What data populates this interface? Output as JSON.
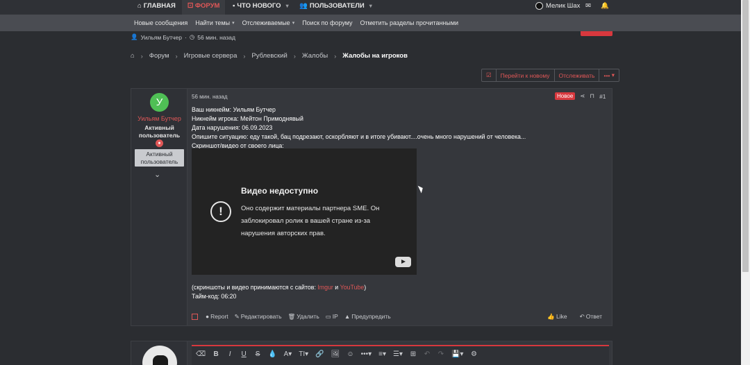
{
  "topnav": {
    "items": [
      {
        "label": "ГЛАВНАЯ",
        "icon": "home-icon"
      },
      {
        "label": "⚀ ФОРУМ",
        "active": true
      },
      {
        "label": "ЧТО НОВОГО",
        "icon": "comment-icon"
      },
      {
        "label": "ПОЛЬЗОВАТЕЛИ",
        "icon": "users-icon"
      }
    ],
    "user_name": "Мелик Шах"
  },
  "subnav": {
    "items": [
      "Новые сообщения",
      "Найти темы",
      "Отслеживаемые",
      "Поиск по форуму",
      "Отметить разделы прочитанными"
    ]
  },
  "thread_meta": {
    "author": "Уильям Бутчер",
    "time": "56 мин. назад"
  },
  "breadcrumb": [
    "Форум",
    "Игровые сервера",
    "Рублевский",
    "Жалобы",
    "Жалобы на игроков"
  ],
  "actions": {
    "goto_new": "Перейти к новому",
    "watch": "Отслеживать",
    "more": "•••"
  },
  "post": {
    "avatar_letter": "У",
    "username": "Уильям Бутчер",
    "user_title": "Активный пользователь",
    "user_banner": "Активный пользователь",
    "time": "56 мин. назад",
    "new_badge": "Новое",
    "number": "#1",
    "lines": [
      "Ваш никнейм: Уильям Бутчер",
      "Никнейм игрока: Мейтон Примоднявый",
      "Дата нарушения: 06.09.2023",
      "Опишите ситуацию: еду такой, бац подрезают, оскорбляют и в итоге убивают....очень много нарушений от человека...",
      "Скриншот/видео от своего лица:"
    ],
    "video": {
      "title": "Видео недоступно",
      "message": "Оно содержит материалы партнера SME. Он заблокировал ролик в вашей стране из-за нарушения авторских прав."
    },
    "after_prefix": "(скриншоты и видео принимаются с сайтов: ",
    "link1": "Imgur",
    "and": " и ",
    "link2": "YouTube",
    "after_suffix": ")",
    "timecode": "Тайм-код: 06:20",
    "footer": {
      "report": "Report",
      "edit": "Редактировать",
      "delete": "Удалить",
      "ip": "IP",
      "warn": "Предупредить",
      "like": "Like",
      "reply": "Ответ"
    }
  },
  "editor": {
    "tools": [
      "⌫",
      "B",
      "I",
      "U",
      "S",
      "💧",
      "A▾",
      "TI▾",
      "🔗",
      "🖼",
      "☺",
      "•••▾",
      "≡▾",
      "☰▾",
      "⊞",
      "↶",
      "↷",
      "💾▾",
      "⚙"
    ]
  }
}
